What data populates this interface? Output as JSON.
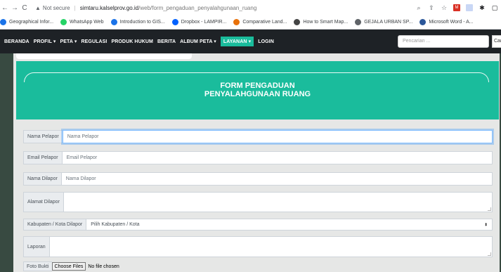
{
  "browser": {
    "back": "←",
    "forward": "→",
    "reload": "C",
    "warning_icon": "▲",
    "not_secure": "Not secure",
    "url_host": "simtaru.kalselprov.go.id",
    "url_path": "/web/form_pengaduan_penyalahgunaan_ruang",
    "icons": [
      "search-icon",
      "share-icon",
      "star-icon",
      "extension-icon",
      "puzzle-icon",
      "sidebar-icon"
    ]
  },
  "bookmarks": [
    {
      "label": "Geographical Infor...",
      "color": "#1a73e8"
    },
    {
      "label": "WhatsApp Web",
      "color": "#25d366"
    },
    {
      "label": "Introduction to GIS...",
      "color": "#1a73e8"
    },
    {
      "label": "Dropbox - LAMPIR...",
      "color": "#0061ff"
    },
    {
      "label": "Comparative Land...",
      "color": "#e8710a"
    },
    {
      "label": "How to Smart Map...",
      "color": "#444444"
    },
    {
      "label": "GEJALA URBAN SP...",
      "color": "#5f6368"
    },
    {
      "label": "Microsoft Word - A...",
      "color": "#2b579a"
    }
  ],
  "nav": {
    "items": [
      "BERANDA",
      "PROFIL ▾",
      "PETA ▾",
      "REGULASI",
      "PRODUK HUKUM",
      "BERITA",
      "ALBUM PETA ▾",
      "LAYANAN ▾",
      "LOGIN"
    ],
    "search_placeholder": "Pencarian ...",
    "search_button": "Car"
  },
  "header": {
    "line1": "FORM PENGADUAN",
    "line2": "PENYALAHGUNAAN RUANG"
  },
  "form": {
    "nama_pelapor": {
      "label": "Nama Pelapor",
      "placeholder": "Nama Pelapor"
    },
    "email_pelapor": {
      "label": "Email Pelapor",
      "placeholder": "Email Pelapor"
    },
    "nama_dilapor": {
      "label": "Nama Dilapor",
      "placeholder": "Nama Dilapor"
    },
    "alamat_dilapor": {
      "label": "Alamat Dilapor",
      "placeholder": ""
    },
    "kabupaten": {
      "label": "Kabupaten / Kota Dilapor",
      "selected": "Pilih Kabupaten / Kota"
    },
    "laporan": {
      "label": "Laporan",
      "placeholder": ""
    },
    "foto": {
      "label": "Foto Bukti",
      "button": "Choose Files",
      "status": "No file chosen"
    }
  },
  "colors": {
    "accent": "#1abc9c",
    "navbar": "#1e2226",
    "page_bg": "#384a41"
  }
}
